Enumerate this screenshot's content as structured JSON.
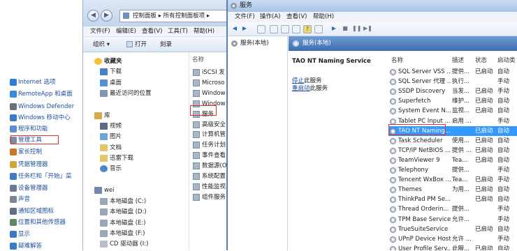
{
  "control_panel": {
    "items": [
      {
        "label": "Internet 选项",
        "icon": "globe-icon",
        "color": "#2f7fd0"
      },
      {
        "label": "RemoteApp 和桌面",
        "icon": "remote-icon",
        "color": "#3a8bd8"
      },
      {
        "label": "Windows Defender",
        "icon": "defender-icon",
        "color": "#6a6f7a"
      },
      {
        "label": "Windows 移动中心",
        "icon": "mobility-icon",
        "color": "#3f7bc4"
      },
      {
        "label": "程序和功能",
        "icon": "programs-icon",
        "color": "#5b8ed0"
      },
      {
        "label": "管理工具",
        "icon": "admin-tools-icon",
        "color": "#7d8aa0"
      },
      {
        "label": "家长控制",
        "icon": "parental-icon",
        "color": "#c9772a"
      },
      {
        "label": "凭据管理器",
        "icon": "credential-icon",
        "color": "#d3a63a"
      },
      {
        "label": "任务栏和「开始」菜",
        "icon": "taskbar-icon",
        "color": "#3f7bc4"
      },
      {
        "label": "设备管理器",
        "icon": "device-manager-icon",
        "color": "#6c7b93"
      },
      {
        "label": "声音",
        "icon": "sound-icon",
        "color": "#7b8595"
      },
      {
        "label": "通知区域图标",
        "icon": "notification-icon",
        "color": "#5f6f86"
      },
      {
        "label": "位置和其他传感器",
        "icon": "sensor-icon",
        "color": "#5c8a5c"
      },
      {
        "label": "显示",
        "icon": "display-icon",
        "color": "#3a7bc8"
      },
      {
        "label": "疑难解答",
        "icon": "troubleshoot-icon",
        "color": "#3a7bc8"
      }
    ]
  },
  "explorer": {
    "address": "控制面板 ▸ 所有控制面板项 ▸",
    "menu": [
      "文件(F)",
      "编辑(E)",
      "查看(V)",
      "工具(T)",
      "帮助(H)"
    ],
    "toolbar": [
      "组织 ▾",
      "打开",
      "刻录"
    ],
    "nav": {
      "favorites_label": "收藏夹",
      "favorites": [
        "下载",
        "桌面",
        "最近访问的位置"
      ],
      "libraries_label": "库",
      "libraries": [
        "视频",
        "图片",
        "文档",
        "迅雷下载",
        "音乐"
      ],
      "computer_label": "wei",
      "drives": [
        "本地磁盘 (C:)",
        "本地磁盘 (D:)",
        "本地磁盘 (E:)",
        "本地磁盘 (F:)",
        "CD 驱动器 (I:)"
      ]
    },
    "files_header": "名称",
    "files": [
      "iSCSI 发",
      "Microso",
      "Window",
      "Window",
      "服务",
      "高级安全",
      "计算机管",
      "任务计划",
      "事件查看",
      "数据源(O",
      "系统配置",
      "性能监视",
      "组件服务"
    ]
  },
  "services": {
    "title": "服务",
    "menu": [
      "文件(F)",
      "操作(A)",
      "查看(V)",
      "帮助(H)"
    ],
    "tree_item": "服务(本地)",
    "header": "服务(本地)",
    "selected_name": "TAO NT Naming Service",
    "stop_link": "停止",
    "stop_text": "此服务",
    "restart_link": "重启动",
    "restart_text": "此服务",
    "columns": [
      "名称",
      "描述",
      "状态",
      "启动类"
    ],
    "rows": [
      {
        "name": "SQL Server VSS ...",
        "desc": "提供...",
        "status": "已启动",
        "startup": "自动"
      },
      {
        "name": "SQL Server 代理 ...",
        "desc": "执行...",
        "status": "",
        "startup": "手动"
      },
      {
        "name": "SSDP Discovery",
        "desc": "当发...",
        "status": "已启动",
        "startup": "手动"
      },
      {
        "name": "Superfetch",
        "desc": "维护...",
        "status": "已启动",
        "startup": "自动"
      },
      {
        "name": "System Event N...",
        "desc": "监视...",
        "status": "已启动",
        "startup": "自动"
      },
      {
        "name": "Tablet PC Input ...",
        "desc": "启用 ...",
        "status": "",
        "startup": "手动"
      },
      {
        "name": "TAO NT Naming...",
        "desc": "",
        "status": "已启动",
        "startup": "自动",
        "selected": true
      },
      {
        "name": "Task Scheduler",
        "desc": "使用...",
        "status": "已启动",
        "startup": "自动"
      },
      {
        "name": "TCP/IP NetBIOS ...",
        "desc": "提供 ...",
        "status": "已启动",
        "startup": "自动"
      },
      {
        "name": "TeamViewer 9",
        "desc": "Tea...",
        "status": "已启动",
        "startup": "自动"
      },
      {
        "name": "Telephony",
        "desc": "提供...",
        "status": "",
        "startup": "手动"
      },
      {
        "name": "Tencent WxBox ...",
        "desc": "Tea...",
        "status": "已启动",
        "startup": "手动"
      },
      {
        "name": "Themes",
        "desc": "为用...",
        "status": "已启动",
        "startup": "自动"
      },
      {
        "name": "ThinkPad PM Se...",
        "desc": "",
        "status": "已启动",
        "startup": "自动"
      },
      {
        "name": "Thread Orderin...",
        "desc": "提供...",
        "status": "",
        "startup": "手动"
      },
      {
        "name": "TPM Base Service",
        "desc": "允许...",
        "status": "",
        "startup": "手动"
      },
      {
        "name": "TrueSuiteService",
        "desc": "",
        "status": "已启动",
        "startup": "自动"
      },
      {
        "name": "UPnP Device Host",
        "desc": "允许 ...",
        "status": "",
        "startup": "手动"
      },
      {
        "name": "User Profile Serv...",
        "desc": "此服...",
        "status": "已启动",
        "startup": "自动"
      }
    ]
  }
}
